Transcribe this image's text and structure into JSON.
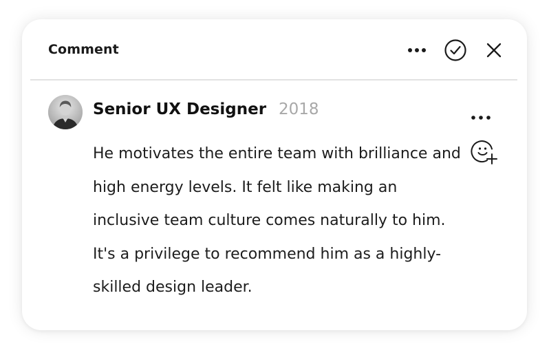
{
  "header": {
    "title": "Comment",
    "icons": [
      "more-horizontal-icon",
      "check-circle-icon",
      "close-icon"
    ]
  },
  "comment": {
    "author": "Senior UX Designer",
    "year": "2018",
    "text": "He motivates the entire team with brilliance and high energy levels. It felt like making an inclusive team culture comes naturally to him. It's a privilege to recommend him as a highly-skilled design leader.",
    "icons": [
      "more-horizontal-icon",
      "add-reaction-icon"
    ]
  },
  "colors": {
    "text": "#1c1c1c",
    "muted": "#a8a8a8",
    "divider": "#e2e2e2",
    "background": "#ffffff"
  }
}
